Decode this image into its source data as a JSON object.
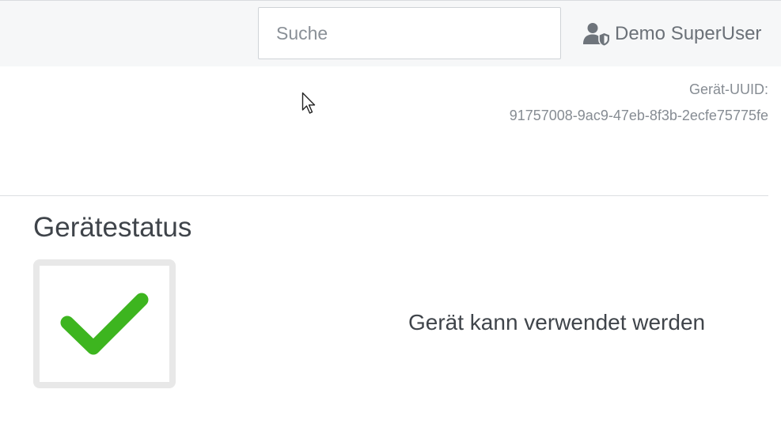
{
  "header": {
    "search": {
      "placeholder": "Suche",
      "value": ""
    },
    "user": {
      "name": "Demo SuperUser",
      "icon": "user-shield-icon"
    }
  },
  "device": {
    "uuid_label": "Gerät-UUID:",
    "uuid_value": "91757008-9ac9-47eb-8f3b-2ecfe75775fe"
  },
  "status": {
    "title": "Gerätestatus",
    "icon": "checkmark-icon",
    "message": "Gerät kann verwendet werden"
  },
  "colors": {
    "check": "#3db51f",
    "topbar": "#f6f7f8",
    "box_border": "#e8e8e8"
  }
}
